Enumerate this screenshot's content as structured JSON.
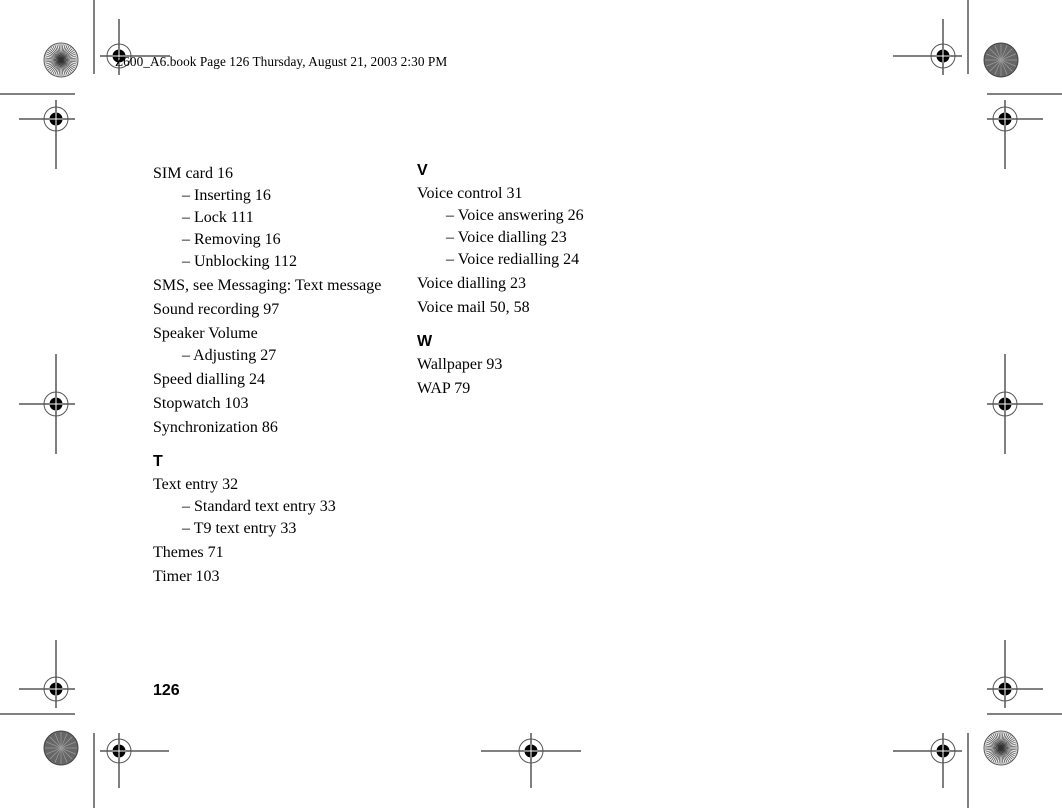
{
  "header": {
    "text": "Z600_A6.book  Page 126  Thursday, August 21, 2003  2:30 PM"
  },
  "index": {
    "left_column": [
      {
        "type": "main",
        "text": "SIM card  16"
      },
      {
        "type": "sub",
        "text": "– Inserting  16"
      },
      {
        "type": "sub",
        "text": "– Lock  111"
      },
      {
        "type": "sub",
        "text": "– Removing  16"
      },
      {
        "type": "sub",
        "text": "– Unblocking  112"
      },
      {
        "type": "main",
        "text": "SMS, see Messaging: Text message"
      },
      {
        "type": "main",
        "text": "Sound recording  97"
      },
      {
        "type": "main",
        "text": "Speaker Volume"
      },
      {
        "type": "sub",
        "text": "– Adjusting  27"
      },
      {
        "type": "main",
        "text": "Speed dialling  24"
      },
      {
        "type": "main",
        "text": "Stopwatch  103"
      },
      {
        "type": "main",
        "text": "Synchronization  86"
      },
      {
        "type": "gap"
      },
      {
        "type": "letter",
        "text": "T"
      },
      {
        "type": "main",
        "text": "Text entry  32"
      },
      {
        "type": "sub",
        "text": "– Standard text entry  33"
      },
      {
        "type": "sub",
        "text": "– T9 text entry  33"
      },
      {
        "type": "main",
        "text": "Themes  71"
      },
      {
        "type": "main",
        "text": "Timer  103"
      }
    ],
    "right_column": [
      {
        "type": "letter",
        "text": "V"
      },
      {
        "type": "main",
        "text": "Voice control  31"
      },
      {
        "type": "sub",
        "text": "– Voice answering  26"
      },
      {
        "type": "sub",
        "text": "– Voice dialling  23"
      },
      {
        "type": "sub",
        "text": "– Voice redialling  24"
      },
      {
        "type": "main",
        "text": "Voice dialling  23"
      },
      {
        "type": "main",
        "text": "Voice mail  50,  58"
      },
      {
        "type": "gap"
      },
      {
        "type": "letter",
        "text": "W"
      },
      {
        "type": "main",
        "text": "Wallpaper  93"
      },
      {
        "type": "main",
        "text": "WAP  79"
      }
    ]
  },
  "footer": {
    "page_number": "126"
  },
  "print_marks": {
    "registration_targets": [
      "top-left",
      "top-right",
      "upper-left",
      "upper-right",
      "middle-left",
      "middle-right",
      "lower-left",
      "lower-right",
      "bottom-left",
      "bottom-center",
      "bottom-right"
    ],
    "color_wheels": [
      "top-left-fine",
      "top-right-dark",
      "bottom-left-dark",
      "bottom-right-fine"
    ]
  }
}
